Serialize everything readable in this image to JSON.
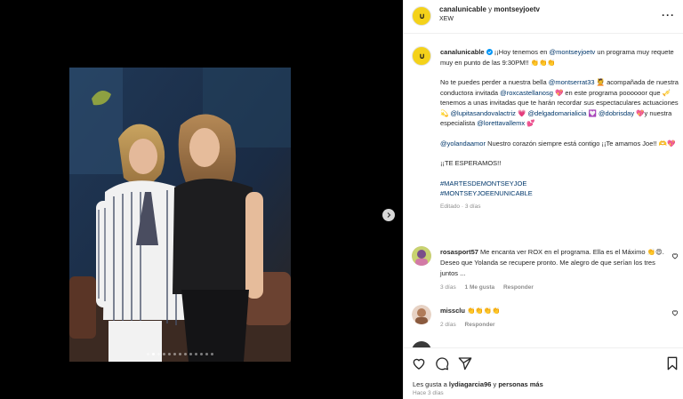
{
  "post": {
    "header": {
      "account": "canalunicable",
      "connector": "y",
      "collaborator": "montseyjoetv",
      "subtitle": "XEW"
    },
    "caption": {
      "username": "canalunicable",
      "p1_a": " ¡¡Hoy tenemos en ",
      "p1_mention": "@montseyjoetv",
      "p1_b": " un programa muy requete muy en punto de las 9:30PM!! 👏👏👏",
      "p2_a": "No te puedes perder a nuestra bella ",
      "p2_m1": "@montserrat33",
      "p2_b": " 💆 acompañada de nuestra conductora invitada ",
      "p2_m2": "@roxcastellanosg",
      "p2_c": " 💖 en este programa poooooor que 🎺 tenemos a unas invitadas que te harán recordar sus espectaculares actuaciones 💫 ",
      "p2_m3": "@lupitasandovalactriz",
      "p2_d": " 💗 ",
      "p2_m4": "@delgadomarialicia",
      "p2_e": " 💟 ",
      "p2_m5": "@dobrisday",
      "p2_f": " 💖y nuestra especialista ",
      "p2_m6": "@lorettavallemx",
      "p2_g": " 💕",
      "p3_mention": "@yolandaamor",
      "p3_text": " Nuestro corazón siempre está contigo ¡¡Te amamos Joe!! 🫶💖",
      "p4": "¡¡TE ESPERAMOS!!",
      "hashtag1": "#MARTESDEMONTSEYJOE",
      "hashtag2": "#MONTSEYJOEENUNICABLE",
      "edited": "Editado · 3 días"
    },
    "comments": [
      {
        "user": "rosasport57",
        "text": " Me encanta ver ROX en el programa. Ella es el Máximo 👏😍. Deseo que Yolanda se recupere pronto. Me alegro de que serían los tres juntos ...",
        "age": "3 días",
        "likes": "1 Me gusta",
        "reply": "Responder"
      },
      {
        "user": "missclu",
        "text": " 👏👏👏👏",
        "age": "2 días",
        "reply": "Responder"
      }
    ],
    "likes": {
      "prefix": "Les gusta a ",
      "user": "lydiagarcia96",
      "middle": " y ",
      "others": "personas más"
    },
    "time": "Hace 3 días",
    "carousel": {
      "count": 13,
      "active": 1
    },
    "colors": {
      "brand_yellow": "#f4d21a",
      "mention": "#00376b",
      "muted": "#8e8e8e",
      "verified": "#0095f6"
    }
  }
}
